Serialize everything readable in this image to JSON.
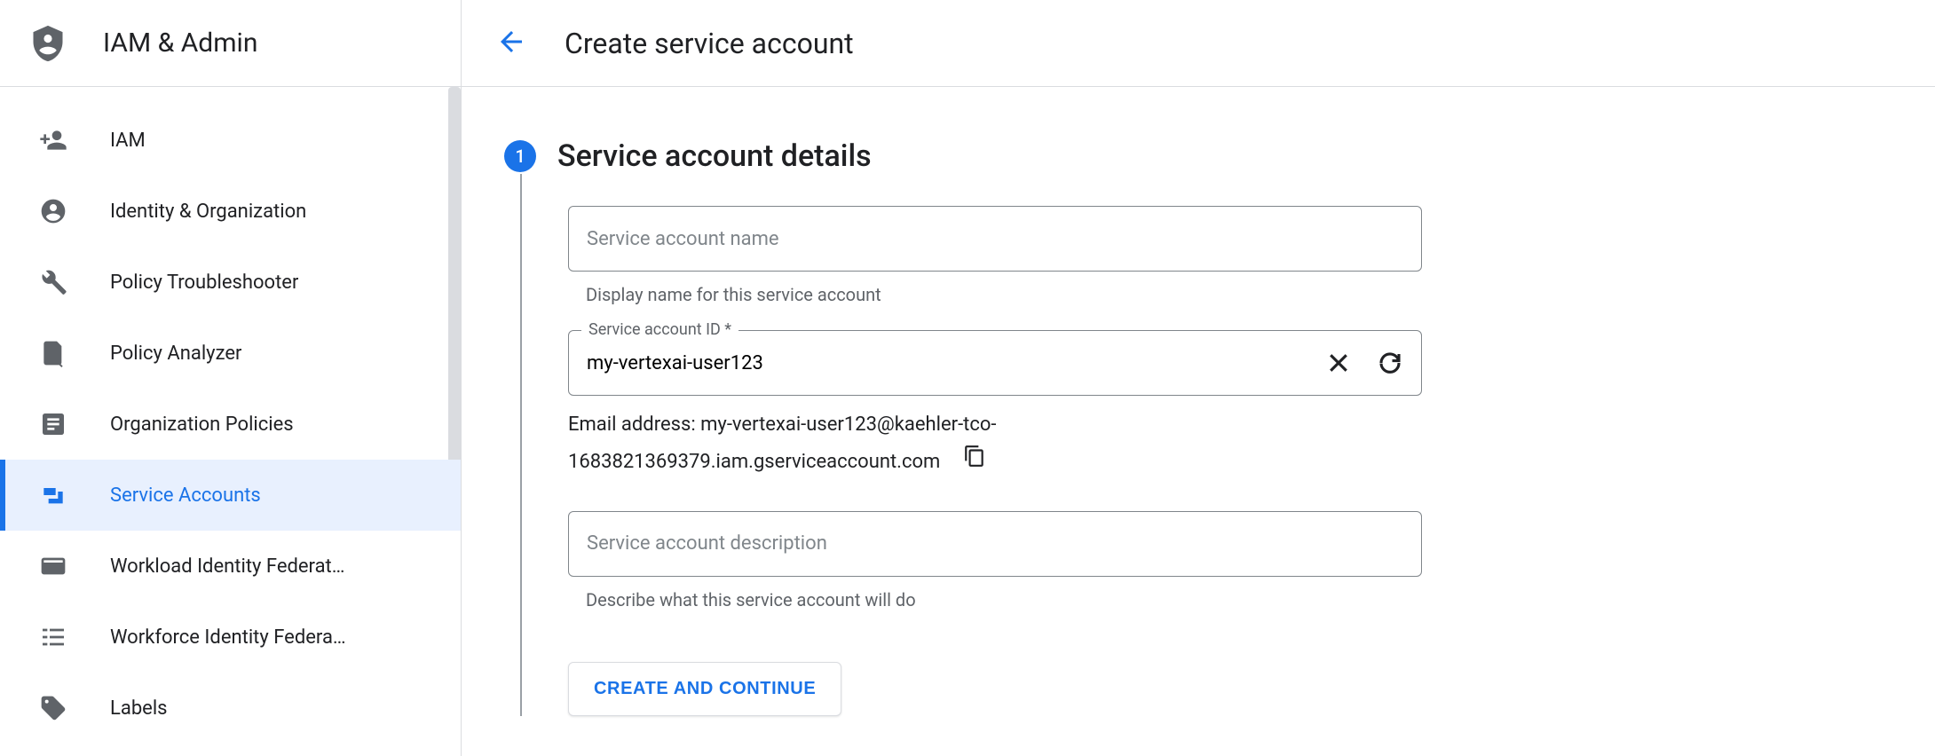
{
  "sidebar": {
    "title": "IAM & Admin",
    "items": [
      {
        "label": "IAM"
      },
      {
        "label": "Identity & Organization"
      },
      {
        "label": "Policy Troubleshooter"
      },
      {
        "label": "Policy Analyzer"
      },
      {
        "label": "Organization Policies"
      },
      {
        "label": "Service Accounts"
      },
      {
        "label": "Workload Identity Federat…"
      },
      {
        "label": "Workforce Identity Federa…"
      },
      {
        "label": "Labels"
      }
    ]
  },
  "header": {
    "title": "Create service account"
  },
  "step": {
    "number": "1",
    "title": "Service account details"
  },
  "form": {
    "name": {
      "placeholder": "Service account name",
      "helper": "Display name for this service account"
    },
    "id": {
      "label": "Service account ID *",
      "value": "my-vertexai-user123"
    },
    "email_prefix": "Email address: ",
    "email_line1": "my-vertexai-user123@kaehler-tco-",
    "email_line2": "1683821369379.iam.gserviceaccount.com",
    "description": {
      "placeholder": "Service account description",
      "helper": "Describe what this service account will do"
    },
    "submit_label": "CREATE AND CONTINUE"
  }
}
